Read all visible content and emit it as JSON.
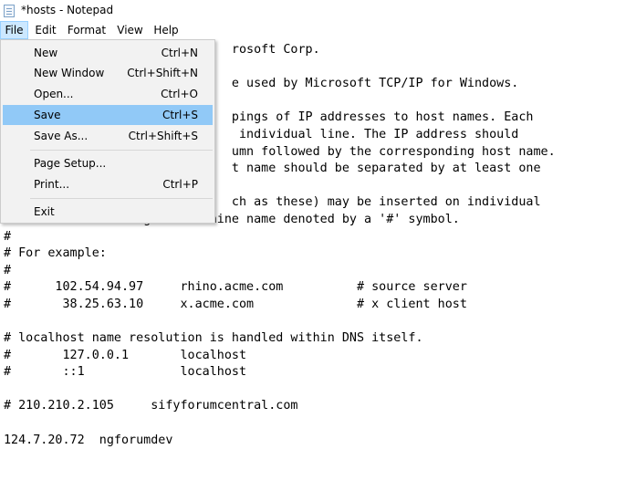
{
  "window": {
    "title": "*hosts - Notepad",
    "icon": "notepad-icon"
  },
  "menubar": {
    "items": [
      "File",
      "Edit",
      "Format",
      "View",
      "Help"
    ]
  },
  "file_menu": {
    "items": [
      {
        "label": "New",
        "shortcut": "Ctrl+N"
      },
      {
        "label": "New Window",
        "shortcut": "Ctrl+Shift+N"
      },
      {
        "label": "Open...",
        "shortcut": "Ctrl+O"
      },
      {
        "label": "Save",
        "shortcut": "Ctrl+S"
      },
      {
        "label": "Save As...",
        "shortcut": "Ctrl+Shift+S"
      },
      {
        "label": "Page Setup...",
        "shortcut": ""
      },
      {
        "label": "Print...",
        "shortcut": "Ctrl+P"
      },
      {
        "label": "Exit",
        "shortcut": ""
      }
    ],
    "selected": "Save"
  },
  "colors": {
    "menu_highlight": "#91c9f7",
    "menubar_active": "#cce8ff"
  },
  "editor": {
    "content": "                               rosoft Corp.\n#\n                               e used by Microsoft TCP/IP for Windows.\n#\n                               pings of IP addresses to host names. Each\n                                individual line. The IP address should\n                               umn followed by the corresponding host name.\n                               t name should be separated by at least one\n#\n#                              ch as these) may be inserted on individual\n# lines or following the machine name denoted by a '#' symbol.\n#\n# For example:\n#\n#      102.54.94.97     rhino.acme.com          # source server\n#       38.25.63.10     x.acme.com              # x client host\n\n# localhost name resolution is handled within DNS itself.\n#       127.0.0.1       localhost\n#       ::1             localhost\n\n# 210.210.2.105     sifyforumcentral.com\n\n124.7.20.72  ngforumdev"
  }
}
